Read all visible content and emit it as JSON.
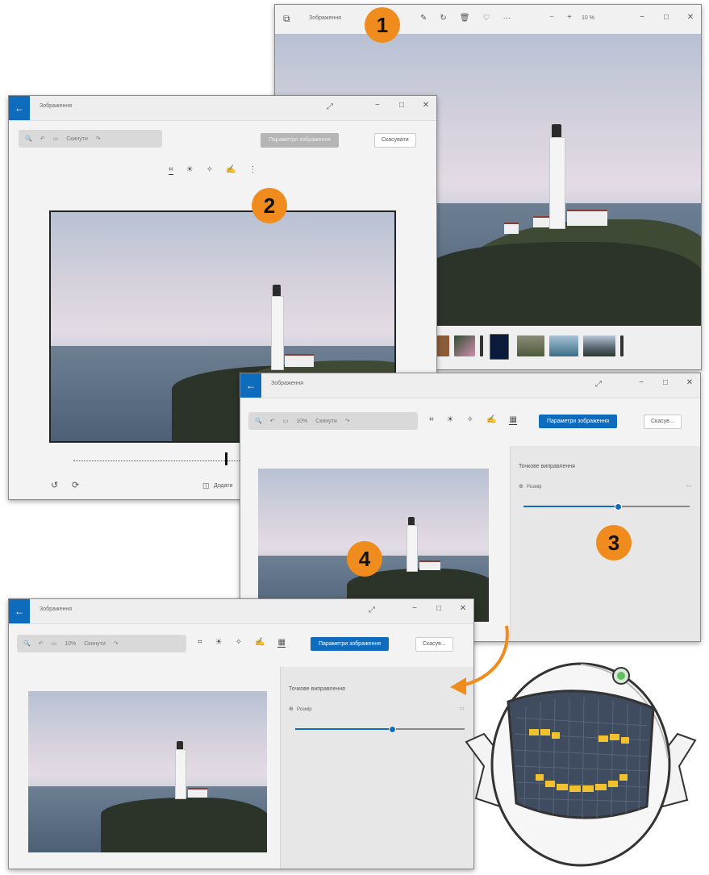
{
  "app": {
    "title": "Зображення"
  },
  "window1": {
    "toolbar_icons": [
      "edit-icon",
      "rotate-icon",
      "delete-icon",
      "favorite-icon",
      "more-icon"
    ],
    "zoom_out": "−",
    "zoom_in": "+",
    "zoom_level": "10 %"
  },
  "window2": {
    "title": "Зображення",
    "toolbar_labels": {
      "reset": "Скинути"
    },
    "adjust_button": "Параметри зображення",
    "save_button": "Скасувати",
    "save_copy": "Додати"
  },
  "window3": {
    "title": "Зображення",
    "zoom_level": "10%",
    "reset": "Скинути",
    "adjust_button": "Параметри зображення",
    "cancel_button": "Скасув...",
    "panel_title": "Точкове виправлення",
    "size_label": "Розмір",
    "size_fraction": 0.57
  },
  "window4": {
    "title": "Зображення",
    "zoom_level": "10%",
    "reset": "Скинути",
    "adjust_button": "Параметри зображення",
    "cancel_button": "Скасув...",
    "panel_title": "Точкове виправлення",
    "size_label": "Розмір",
    "size_fraction": 0.57
  },
  "badges": {
    "one": "1",
    "two": "2",
    "three": "3",
    "four": "4"
  },
  "colors": {
    "accent": "#0f6cbd",
    "badge": "#f08c1e"
  }
}
